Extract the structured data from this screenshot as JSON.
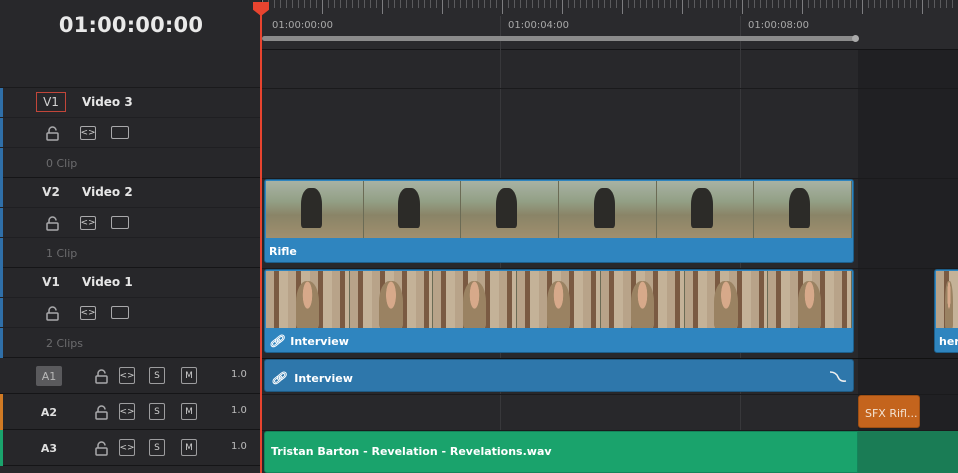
{
  "timecode": "01:00:00:00",
  "ruler": {
    "timecodes": [
      "01:00:00:00",
      "01:00:04:00",
      "01:00:08:00"
    ]
  },
  "tracks": {
    "video": [
      {
        "id": "V1",
        "name": "Video 3",
        "clip_count": "0 Clip"
      },
      {
        "id": "V2",
        "name": "Video 2",
        "clip_count": "1 Clip"
      },
      {
        "id": "V1",
        "name": "Video 1",
        "clip_count": "2 Clips"
      }
    ],
    "audio": [
      {
        "id": "A1",
        "volume": "1.0"
      },
      {
        "id": "A2",
        "volume": "1.0"
      },
      {
        "id": "A3",
        "volume": "1.0"
      }
    ],
    "button_labels": {
      "solo": "S",
      "mute": "M",
      "auto_select": "<>"
    }
  },
  "clips": {
    "rifle": "Rifle",
    "interview_video": "Interview",
    "interview_partial": "here",
    "interview_audio": "Interview",
    "sfx": "SFX Rifl...",
    "music": "Tristan Barton - Revelation - Revelations.wav"
  },
  "colors": {
    "playhead": "#e8442f",
    "video_clip": "#2f85bf",
    "audio_clip": "#2e77ab",
    "music_clip": "#1aa36c",
    "sfx_clip": "#c4641d",
    "track_accent_video": "#2f6fa8",
    "track_accent_audio": "#d07a24",
    "track_accent_music": "#1aa36c"
  }
}
